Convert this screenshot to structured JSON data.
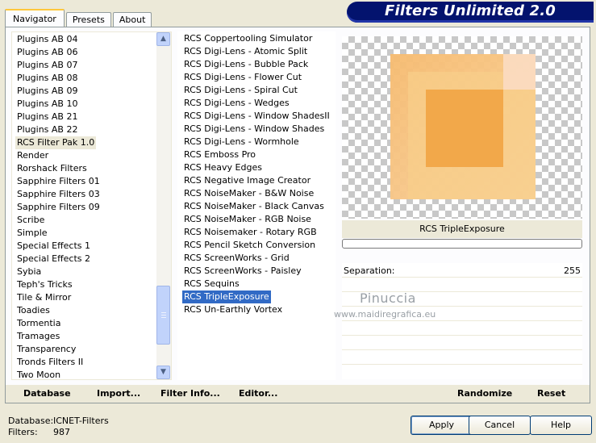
{
  "tabs": [
    "Navigator",
    "Presets",
    "About"
  ],
  "title": "Filters Unlimited 2.0",
  "categories": [
    "Plugins AB 04",
    "Plugins AB 06",
    "Plugins AB 07",
    "Plugins AB 08",
    "Plugins AB 09",
    "Plugins AB 10",
    "Plugins AB 21",
    "Plugins AB 22",
    "RCS Filter Pak 1.0",
    "Render",
    "Rorshack Filters",
    "Sapphire Filters 01",
    "Sapphire Filters 03",
    "Sapphire Filters 09",
    "Scribe",
    "Simple",
    "Special Effects 1",
    "Special Effects 2",
    "Sybia",
    "Teph's Tricks",
    "Tile & Mirror",
    "Toadies",
    "Tormentia",
    "Tramages",
    "Transparency",
    "Tronds Filters II",
    "Two Moon"
  ],
  "selected_category": "RCS Filter Pak 1.0",
  "filters": [
    "RCS Coppertooling Simulator",
    "RCS Digi-Lens - Atomic Split",
    "RCS Digi-Lens - Bubble Pack",
    "RCS Digi-Lens - Flower Cut",
    "RCS Digi-Lens - Spiral Cut",
    "RCS Digi-Lens - Wedges",
    "RCS Digi-Lens - Window ShadesII",
    "RCS Digi-Lens - Window Shades",
    "RCS Digi-Lens - Wormhole",
    "RCS Emboss Pro",
    "RCS Heavy Edges",
    "RCS Negative Image Creator",
    "RCS NoiseMaker - B&W Noise",
    "RCS NoiseMaker - Black Canvas",
    "RCS NoiseMaker - RGB Noise",
    "RCS Noisemaker - Rotary RGB",
    "RCS Pencil Sketch Conversion",
    "RCS ScreenWorks - Grid",
    "RCS ScreenWorks - Paisley",
    "RCS Sequins",
    "RCS TripleExposure",
    "RCS Un-Earthly Vortex"
  ],
  "selected_filter": "RCS TripleExposure",
  "preview": {
    "filter_name": "RCS TripleExposure"
  },
  "params": [
    {
      "label": "Separation:",
      "value": "255"
    }
  ],
  "watermark": {
    "name": "Pinuccia",
    "url": "www.maidiregrafica.eu"
  },
  "toolbar": {
    "database": "Database",
    "import": "Import...",
    "filter_info": "Filter Info...",
    "editor": "Editor...",
    "randomize": "Randomize",
    "reset": "Reset"
  },
  "status": {
    "database_label": "Database:",
    "database_value": "ICNET-Filters",
    "filters_label": "Filters:",
    "filters_value": "987"
  },
  "buttons": {
    "apply": "Apply",
    "cancel": "Cancel",
    "help": "Help"
  },
  "colors": {
    "banner": "#03136e",
    "selection": "#316ac5",
    "window": "#ece9d8"
  }
}
